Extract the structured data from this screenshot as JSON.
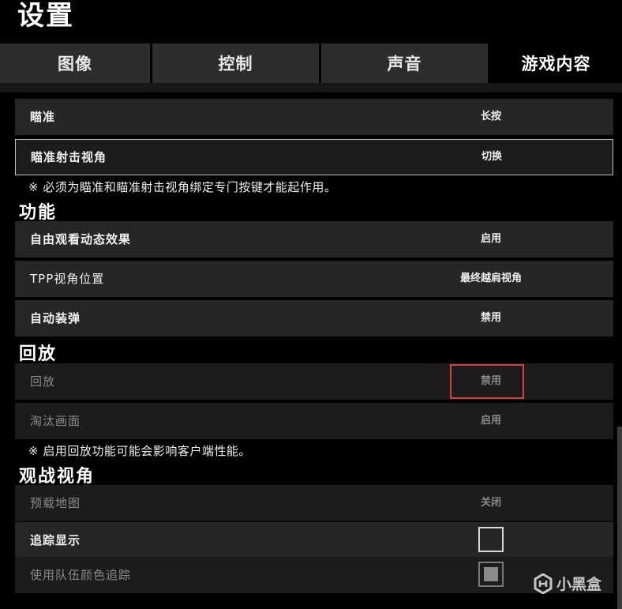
{
  "window": {
    "title": "设置"
  },
  "tabs": [
    {
      "label": "图像",
      "active": false
    },
    {
      "label": "控制",
      "active": false
    },
    {
      "label": "声音",
      "active": false
    },
    {
      "label": "游戏内容",
      "active": true
    }
  ],
  "aim": {
    "rows": [
      {
        "label": "瞄准",
        "value": "长按"
      },
      {
        "label": "瞄准射击视角",
        "value": "切换",
        "selected": true
      }
    ],
    "note": "※ 必须为瞄准和瞄准射击视角绑定专门按键才能起作用。"
  },
  "functions": {
    "title": "功能",
    "rows": [
      {
        "label": "自由观看动态效果",
        "value": "启用"
      },
      {
        "label": "TPP视角位置",
        "value": "最终越肩视角"
      },
      {
        "label": "自动装弹",
        "value": "禁用"
      }
    ]
  },
  "replay": {
    "title": "回放",
    "rows": [
      {
        "label": "回放",
        "value": "禁用",
        "disabled": true
      },
      {
        "label": "淘汰画面",
        "value": "启用",
        "disabled": true
      }
    ],
    "note": "※ 启用回放功能可能会影响客户端性能。"
  },
  "spectate": {
    "title": "观战视角",
    "rows": [
      {
        "label": "预载地图",
        "value": "关闭",
        "disabled": true
      },
      {
        "label": "追踪显示",
        "checked": false
      },
      {
        "label": "使用队伍颜色追踪",
        "checked": true,
        "disabled": true
      }
    ]
  },
  "annotation": {
    "highlight_color": "#d84040"
  },
  "watermark": {
    "text": "小黑盒",
    "icon": "heybox-logo-icon"
  }
}
